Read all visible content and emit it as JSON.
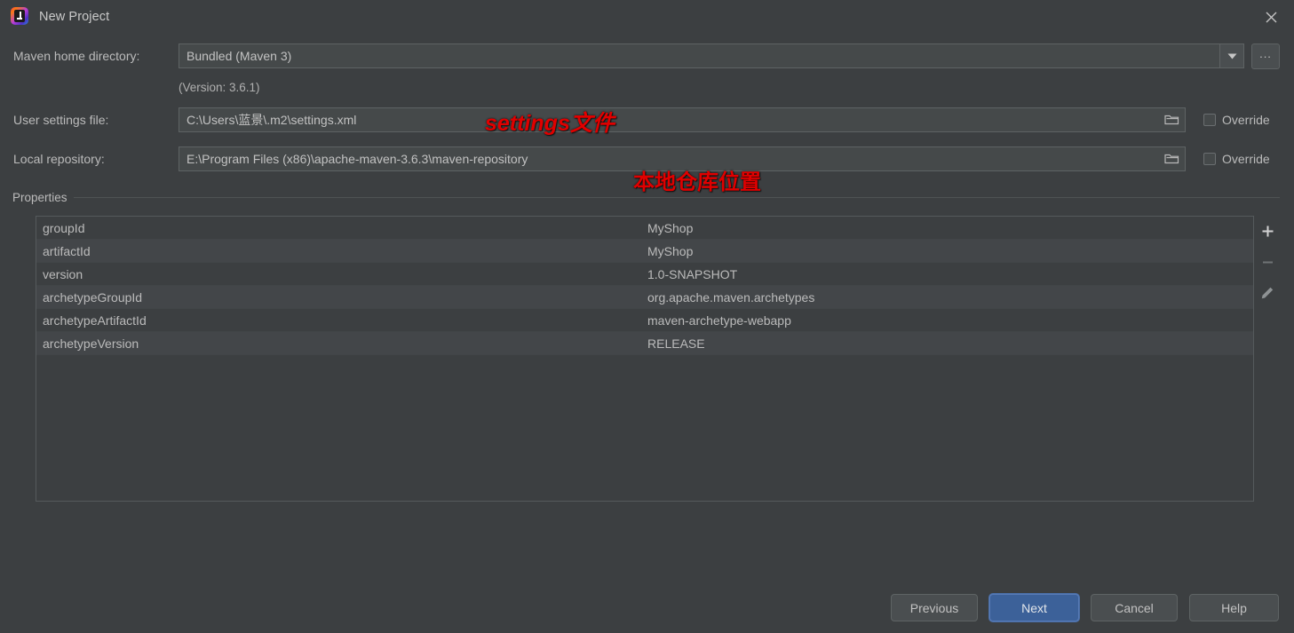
{
  "window": {
    "title": "New Project",
    "icon": "intellij-idea-icon",
    "close_icon": "close-icon"
  },
  "form": {
    "maven_home": {
      "label": "Maven home directory:",
      "value": "Bundled (Maven 3)",
      "version_note": "(Version: 3.6.1)",
      "dropdown_icon": "chevron-down-icon",
      "browse_label": "..."
    },
    "user_settings": {
      "label": "User settings file:",
      "value": "C:\\Users\\蓝景\\.m2\\settings.xml",
      "folder_icon": "folder-icon",
      "override_label": "Override",
      "override_checked": false
    },
    "local_repository": {
      "label": "Local repository:",
      "value": "E:\\Program Files (x86)\\apache-maven-3.6.3\\maven-repository",
      "folder_icon": "folder-icon",
      "override_label": "Override",
      "override_checked": false
    }
  },
  "annotations": [
    {
      "text": "settings文件",
      "color": "#e00000"
    },
    {
      "text": "本地仓库位置",
      "color": "#e00000"
    }
  ],
  "properties": {
    "group_label": "Properties",
    "rows": [
      {
        "key": "groupId",
        "value": "MyShop"
      },
      {
        "key": "artifactId",
        "value": "MyShop"
      },
      {
        "key": "version",
        "value": "1.0-SNAPSHOT"
      },
      {
        "key": "archetypeGroupId",
        "value": "org.apache.maven.archetypes"
      },
      {
        "key": "archetypeArtifactId",
        "value": "maven-archetype-webapp"
      },
      {
        "key": "archetypeVersion",
        "value": "RELEASE"
      }
    ],
    "toolbar": [
      {
        "name": "add-property-button",
        "icon": "plus-icon",
        "enabled": true
      },
      {
        "name": "remove-property-button",
        "icon": "minus-icon",
        "enabled": false
      },
      {
        "name": "edit-property-button",
        "icon": "pencil-icon",
        "enabled": false
      }
    ]
  },
  "footer": {
    "previous": "Previous",
    "next": "Next",
    "cancel": "Cancel",
    "help": "Help",
    "accent_color": "#3c6199"
  }
}
